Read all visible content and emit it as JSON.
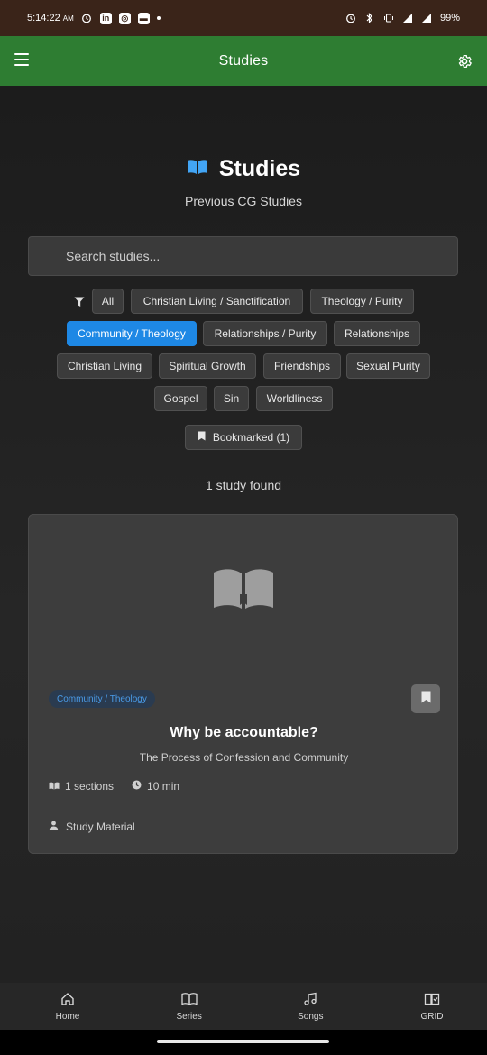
{
  "status_bar": {
    "time": "5:14:22",
    "ampm": "AM",
    "battery": "99%"
  },
  "app_bar": {
    "title": "Studies",
    "menu_icon": "hamburger-menu-icon",
    "settings_icon": "gear-icon",
    "color": "#2e7d32"
  },
  "header": {
    "icon": "open-book-icon",
    "title": "Studies",
    "subtitle": "Previous CG Studies"
  },
  "search": {
    "placeholder": "Search studies..."
  },
  "filters": {
    "icon": "filter-icon",
    "chips": [
      {
        "label": "All",
        "active": false
      },
      {
        "label": "Christian Living / Sanctification",
        "active": false
      },
      {
        "label": "Theology / Purity",
        "active": false
      },
      {
        "label": "Community / Theology",
        "active": true
      },
      {
        "label": "Relationships / Purity",
        "active": false
      },
      {
        "label": "Relationships",
        "active": false
      },
      {
        "label": "Christian Living",
        "active": false
      },
      {
        "label": "Spiritual Growth",
        "active": false
      },
      {
        "label": "Friendships",
        "active": false
      },
      {
        "label": "Sexual Purity",
        "active": false
      },
      {
        "label": "Gospel",
        "active": false
      },
      {
        "label": "Sin",
        "active": false
      },
      {
        "label": "Worldliness",
        "active": false
      }
    ],
    "bookmarked_label": "Bookmarked (1)",
    "active_color": "#1e88e5"
  },
  "results": {
    "count_text": "1 study found"
  },
  "study_card": {
    "tag": "Community / Theology",
    "title": "Why be accountable?",
    "subtitle": "The Process of Confession and Community",
    "sections": "1 sections",
    "duration": "10 min",
    "author": "Study Material"
  },
  "bottom_nav": {
    "items": [
      {
        "label": "Home",
        "icon": "home-icon"
      },
      {
        "label": "Series",
        "icon": "book-icon"
      },
      {
        "label": "Songs",
        "icon": "music-note-icon"
      },
      {
        "label": "GRID",
        "icon": "grid-book-check-icon"
      }
    ]
  }
}
